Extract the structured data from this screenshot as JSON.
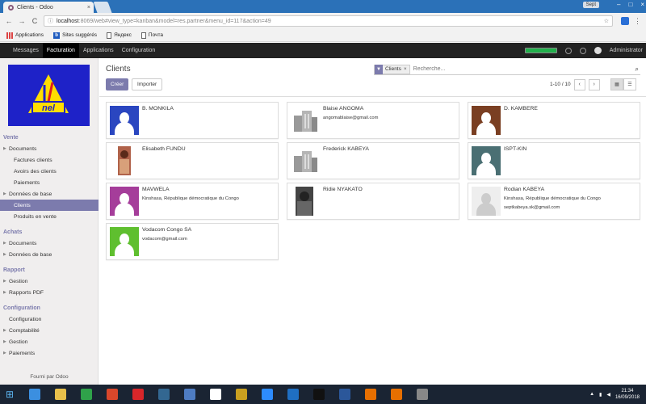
{
  "browser": {
    "tab_title": "Clients - Odoo",
    "tab_close": "×",
    "window_user": "Sept",
    "win_minimize": "–",
    "win_maximize": "□",
    "win_close": "×",
    "url_host": "localhost",
    "url_rest": ":8069/web#view_type=kanban&model=res.partner&menu_id=117&action=49",
    "back_glyph": "←",
    "forward_glyph": "→",
    "reload_glyph": "C",
    "bookmarks": [
      {
        "label": "Applications",
        "icon": "apps-grid-icon"
      },
      {
        "label": "Sites suggérés",
        "icon": "bookmark-b-icon"
      },
      {
        "label": "Яндекс",
        "icon": "document-icon"
      },
      {
        "label": "Почта",
        "icon": "document-icon"
      }
    ]
  },
  "topnav": {
    "items": [
      {
        "label": "Messages",
        "active": false
      },
      {
        "label": "Facturation",
        "active": true
      },
      {
        "label": "Applications",
        "active": false
      },
      {
        "label": "Configuration",
        "active": false
      }
    ],
    "user": "Administrator",
    "progress_fraction": 1.0
  },
  "sidebar": {
    "sections": [
      {
        "title": "Vente",
        "items": [
          {
            "label": "Documents",
            "caret": true,
            "sub": false,
            "active": false
          },
          {
            "label": "Factures clients",
            "caret": false,
            "sub": true,
            "active": false
          },
          {
            "label": "Avoirs des clients",
            "caret": false,
            "sub": true,
            "active": false
          },
          {
            "label": "Paiements",
            "caret": false,
            "sub": true,
            "active": false
          },
          {
            "label": "Données de base",
            "caret": true,
            "sub": false,
            "active": false
          },
          {
            "label": "Clients",
            "caret": false,
            "sub": true,
            "active": true
          },
          {
            "label": "Produits en vente",
            "caret": false,
            "sub": true,
            "active": false
          }
        ]
      },
      {
        "title": "Achats",
        "items": [
          {
            "label": "Documents",
            "caret": true,
            "sub": false,
            "active": false
          },
          {
            "label": "Données de base",
            "caret": true,
            "sub": false,
            "active": false
          }
        ]
      },
      {
        "title": "Rapport",
        "items": [
          {
            "label": "Gestion",
            "caret": true,
            "sub": false,
            "active": false
          },
          {
            "label": "Rapports PDF",
            "caret": true,
            "sub": false,
            "active": false
          }
        ]
      },
      {
        "title": "Configuration",
        "items": [
          {
            "label": "Configuration",
            "caret": false,
            "sub": false,
            "active": false
          },
          {
            "label": "Comptabilité",
            "caret": true,
            "sub": false,
            "active": false
          },
          {
            "label": "Gestion",
            "caret": true,
            "sub": false,
            "active": false
          },
          {
            "label": "Paiements",
            "caret": true,
            "sub": false,
            "active": false
          }
        ]
      }
    ],
    "footer": "Fourni par Odoo"
  },
  "control_panel": {
    "title": "Clients",
    "create_label": "Créer",
    "import_label": "Importer",
    "facet_label": "Clients",
    "facet_remove": "×",
    "search_placeholder": "Recherche...",
    "pager": "1-10 / 10",
    "pager_prev": "‹",
    "pager_next": "›"
  },
  "kanban": [
    {
      "name": "B. MONKILA",
      "line2": "",
      "line3": "",
      "img": "placeholder",
      "color": "#2a46c0"
    },
    {
      "name": "Blaise ANGOMA",
      "line2": "angomablaise@gmail.com",
      "line3": "",
      "img": "company",
      "color": "#bdbdbd"
    },
    {
      "name": "D. KAMBERE",
      "line2": "",
      "line3": "",
      "img": "placeholder",
      "color": "#7a3f22"
    },
    {
      "name": "Elisabeth FUNDU",
      "line2": "",
      "line3": "",
      "img": "photo-warm",
      "color": "#b0624a"
    },
    {
      "name": "Frederick KABEYA",
      "line2": "",
      "line3": "",
      "img": "company",
      "color": "#bdbdbd"
    },
    {
      "name": "ISPT-KIN",
      "line2": "",
      "line3": "",
      "img": "placeholder",
      "color": "#4a6f73"
    },
    {
      "name": "MAVWELA",
      "line2": "Kinshasa, République démocratique du Congo",
      "line3": "",
      "img": "placeholder",
      "color": "#a53d9a"
    },
    {
      "name": "Ridie NYAKATO",
      "line2": "",
      "line3": "",
      "img": "photo-dark",
      "color": "#555555"
    },
    {
      "name": "Rodian KABEYA",
      "line2": "Kinshasa, République démocratique du Congo",
      "line3": "septkabeya.sk@gmail.com",
      "img": "placeholder-light",
      "color": "#eeeeee"
    },
    {
      "name": "Vodacom Congo SA",
      "line2": "vodacom@gmail.com",
      "line3": "",
      "img": "placeholder",
      "color": "#5fbf2f"
    }
  ],
  "taskbar": {
    "time": "21:34",
    "date": "16/09/2018",
    "apps": [
      {
        "icon": "ie-icon",
        "color": "#3b8fe0"
      },
      {
        "icon": "explorer-icon",
        "color": "#e8c04b"
      },
      {
        "icon": "store-icon",
        "color": "#2fa24a"
      },
      {
        "icon": "chrome-icon",
        "color": "#d9472b"
      },
      {
        "icon": "opera-icon",
        "color": "#d7262a"
      },
      {
        "icon": "postgres-icon",
        "color": "#336791"
      },
      {
        "icon": "virtualbox-icon",
        "color": "#4e7cc2"
      },
      {
        "icon": "cursor-app-icon",
        "color": "#ffffff"
      },
      {
        "icon": "paint-icon",
        "color": "#c9a020"
      },
      {
        "icon": "zoom-icon",
        "color": "#2d8cff"
      },
      {
        "icon": "remote-icon",
        "color": "#1f6fc2"
      },
      {
        "icon": "terminal-icon",
        "color": "#111111"
      },
      {
        "icon": "word-icon",
        "color": "#2b579a"
      },
      {
        "icon": "java-icon",
        "color": "#e76f00"
      },
      {
        "icon": "java2-icon",
        "color": "#e76f00"
      },
      {
        "icon": "other-icon",
        "color": "#888888"
      }
    ]
  }
}
